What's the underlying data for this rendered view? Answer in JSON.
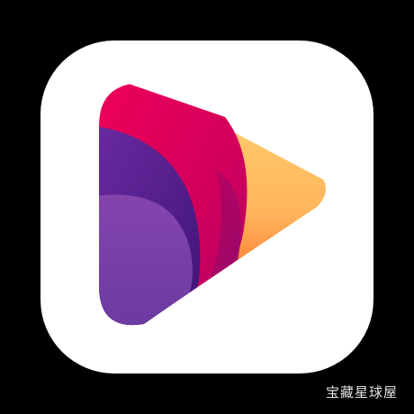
{
  "icon": {
    "name": "play-logo",
    "background_color": "#ffffff",
    "gradient_colors": {
      "red_pink": "#e0004f",
      "magenta": "#c00063",
      "orange": "#ff7a22",
      "yellow": "#ffd070",
      "purple_light": "#7d3fa6",
      "purple_dark": "#4d1a86"
    }
  },
  "watermark": {
    "text": "宝藏星球屋"
  }
}
